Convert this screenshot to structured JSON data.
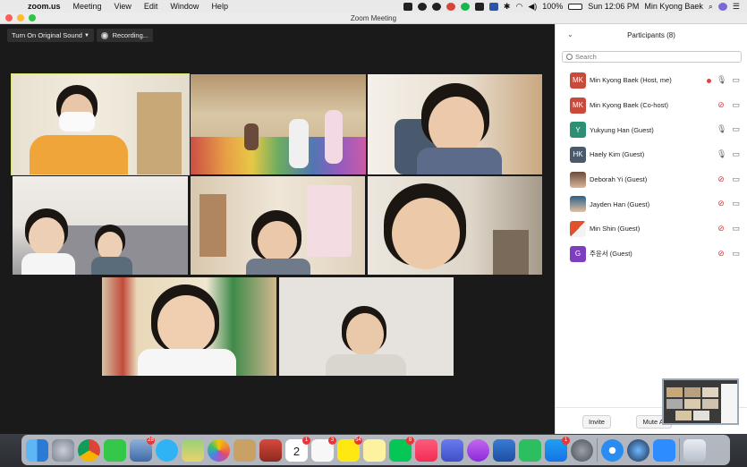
{
  "menubar": {
    "app_name": "zoom.us",
    "menus": [
      "Meeting",
      "View",
      "Edit",
      "Window",
      "Help"
    ],
    "battery": "100%",
    "clock": "Sun 12:06 PM",
    "user": "Min Kyong Baek"
  },
  "window": {
    "title": "Zoom Meeting"
  },
  "toolbar": {
    "original_sound_label": "Turn On Original Sound",
    "recording_label": "Recording..."
  },
  "participants": {
    "title": "Participants (8)",
    "search_placeholder": "Search",
    "list": [
      {
        "initials": "MK",
        "name": "Min Kyong Baek (Host, me)",
        "avatar_color": "#c94a3a",
        "mic": "on",
        "recording": true
      },
      {
        "initials": "MK",
        "name": "Min Kyong Baek (Co-host)",
        "avatar_color": "#c94a3a",
        "mic": "muted"
      },
      {
        "initials": "Y",
        "name": "Yukyung Han (Guest)",
        "avatar_color": "#2d8f74",
        "mic": "on"
      },
      {
        "initials": "HK",
        "name": "Haely Kim (Guest)",
        "avatar_color": "#4a5a6a",
        "mic": "on"
      },
      {
        "initials": "",
        "name": "Deborah Yi (Guest)",
        "avatar_color": "#8a6a55",
        "mic": "muted"
      },
      {
        "initials": "",
        "name": "Jayden Han (Guest)",
        "avatar_color": "#2b5f8a",
        "mic": "muted"
      },
      {
        "initials": "",
        "name": "Min Shin (Guest)",
        "avatar_color": "#e0532a",
        "mic": "muted"
      },
      {
        "initials": "G",
        "name": "주윤서 (Guest)",
        "avatar_color": "#7d3fbf",
        "mic": "muted"
      }
    ],
    "invite_label": "Invite",
    "mute_all_label": "Mute Al"
  },
  "dock": {
    "badges": {
      "photos": "28",
      "calendar": "1",
      "reminders": "3",
      "kakaotalk": "54",
      "line": "8",
      "appstore": "1"
    },
    "calendar_day": "2"
  }
}
